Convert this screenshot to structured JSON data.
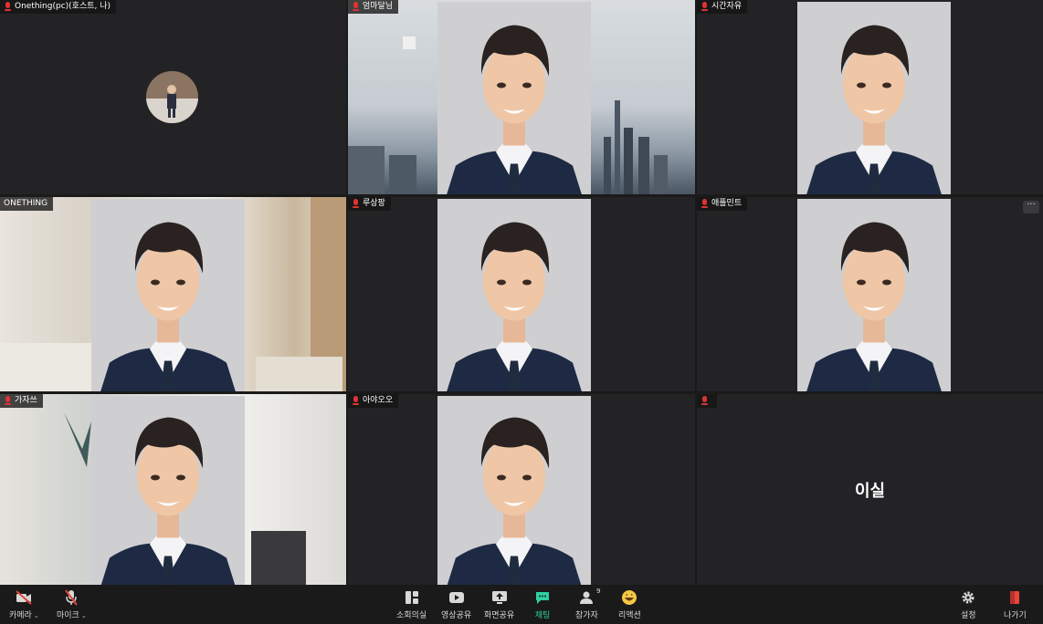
{
  "participants": [
    {
      "name": "Onething(pc)(호스트, 나)",
      "type": "avatar"
    },
    {
      "name": "엄마달님",
      "type": "video"
    },
    {
      "name": "시간자유",
      "type": "video"
    },
    {
      "name": "ONETHING",
      "type": "video"
    },
    {
      "name": "루상팡",
      "type": "video"
    },
    {
      "name": "애플민트",
      "type": "video"
    },
    {
      "name": "가자쓰",
      "type": "video"
    },
    {
      "name": "아야오오",
      "type": "video"
    },
    {
      "name": "",
      "type": "name",
      "display_name": "이실"
    }
  ],
  "more_button": "···",
  "toolbar": {
    "left": [
      {
        "label": "카메라",
        "icon": "camera-off-icon",
        "has_caret": true
      },
      {
        "label": "마이크",
        "icon": "mic-off-icon",
        "has_caret": true
      }
    ],
    "center": [
      {
        "label": "소회의실",
        "icon": "breakout-rooms-icon"
      },
      {
        "label": "영상공유",
        "icon": "video-share-icon"
      },
      {
        "label": "화면공유",
        "icon": "screen-share-icon"
      },
      {
        "label": "채팅",
        "icon": "chat-icon",
        "color": "#2fd0a0"
      },
      {
        "label": "참가자",
        "icon": "participants-icon",
        "badge": "9"
      },
      {
        "label": "리액션",
        "icon": "reaction-icon"
      }
    ],
    "right": [
      {
        "label": "설정",
        "icon": "gear-icon"
      },
      {
        "label": "나가기",
        "icon": "leave-icon",
        "color": "#e5463c"
      }
    ]
  },
  "colors": {
    "muted": "#dd3333",
    "chat": "#2fd0a0",
    "leave": "#e5463c",
    "tile_bg": "#232326"
  }
}
